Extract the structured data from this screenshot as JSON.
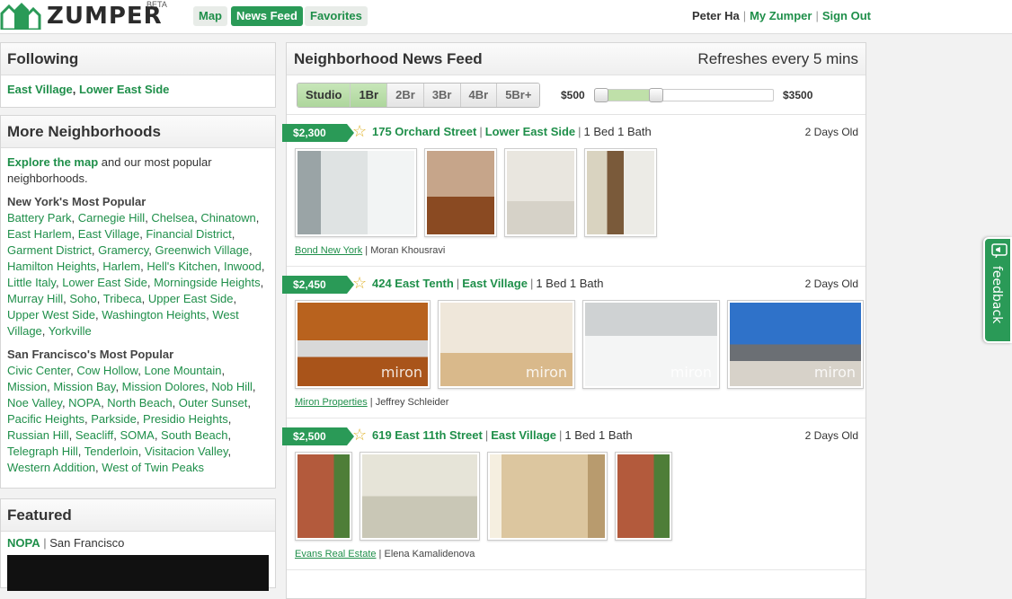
{
  "header": {
    "brand": "ZUMPER",
    "beta": "BETA",
    "nav": [
      {
        "label": "Map",
        "active": false
      },
      {
        "label": "News Feed",
        "active": true
      },
      {
        "label": "Favorites",
        "active": false
      }
    ],
    "user_name": "Peter Ha",
    "my_zumper": "My Zumper",
    "sign_out": "Sign Out"
  },
  "following": {
    "title": "Following",
    "links": [
      "East Village",
      "Lower East Side"
    ]
  },
  "more": {
    "title": "More Neighborhoods",
    "explore_link": "Explore the map",
    "explore_text": " and our most popular neighborhoods.",
    "ny_title": "New York's Most Popular",
    "ny": [
      "Battery Park",
      "Carnegie Hill",
      "Chelsea",
      "Chinatown",
      "East Harlem",
      "East Village",
      "Financial District",
      "Garment District",
      "Gramercy",
      "Greenwich Village",
      "Hamilton Heights",
      "Harlem",
      "Hell's Kitchen",
      "Inwood",
      "Little Italy",
      "Lower East Side",
      "Morningside Heights",
      "Murray Hill",
      "Soho",
      "Tribeca",
      "Upper East Side",
      "Upper West Side",
      "Washington Heights",
      "West Village",
      "Yorkville"
    ],
    "sf_title": "San Francisco's Most Popular",
    "sf": [
      "Civic Center",
      "Cow Hollow",
      "Lone Mountain",
      "Mission",
      "Mission Bay",
      "Mission Dolores",
      "Nob Hill",
      "Noe Valley",
      "NOPA",
      "North Beach",
      "Outer Sunset",
      "Pacific Heights",
      "Parkside",
      "Presidio Heights",
      "Russian Hill",
      "Seacliff",
      "SOMA",
      "South Beach",
      "Telegraph Hill",
      "Tenderloin",
      "Visitacion Valley",
      "Western Addition",
      "West of Twin Peaks"
    ]
  },
  "featured": {
    "title": "Featured",
    "link": "NOPA",
    "city": "San Francisco"
  },
  "feed": {
    "title": "Neighborhood News Feed",
    "refresh": "Refreshes every 5 mins",
    "bedrooms": [
      {
        "label": "Studio",
        "on": true
      },
      {
        "label": "1Br",
        "on": true
      },
      {
        "label": "2Br",
        "on": false
      },
      {
        "label": "3Br",
        "on": false
      },
      {
        "label": "4Br",
        "on": false
      },
      {
        "label": "5Br+",
        "on": false
      }
    ],
    "price_min": "$500",
    "price_max": "$3500",
    "price_range_selected": [
      0.0,
      0.33
    ],
    "listings": [
      {
        "price": "$2,300",
        "address": "175 Orchard Street",
        "neighborhood": "Lower East Side",
        "beds": "1 Bed 1 Bath",
        "age": "2 Days Old",
        "broker": "Bond New York",
        "agent": "Moran Khousravi",
        "photos": [
          "laundry-room",
          "bedroom-wood-floor",
          "bathroom-tile",
          "kitchen-narrow"
        ]
      },
      {
        "price": "$2,450",
        "address": "424 East Tenth",
        "neighborhood": "East Village",
        "beds": "1 Bed 1 Bath",
        "age": "2 Days Old",
        "broker": "Miron Properties",
        "agent": "Jeffrey Schleider",
        "watermark": "miron",
        "photos": [
          "kitchen-wood-cabinets",
          "empty-room-window",
          "laundry-machines",
          "roof-deck"
        ]
      },
      {
        "price": "$2,500",
        "address": "619 East 11th Street",
        "neighborhood": "East Village",
        "beds": "1 Bed 1 Bath",
        "age": "2 Days Old",
        "broker": "Evans Real Estate",
        "agent": "Elena Kamalidenova",
        "photos": [
          "brick-building",
          "bathroom-tub",
          "closet-shelves",
          "brick-building"
        ]
      }
    ]
  },
  "feedback_label": "feedback",
  "colors": {
    "brand_green": "#2a9a57",
    "link_green": "#1f8f4a",
    "slider_fill": "#bfe0a9"
  }
}
